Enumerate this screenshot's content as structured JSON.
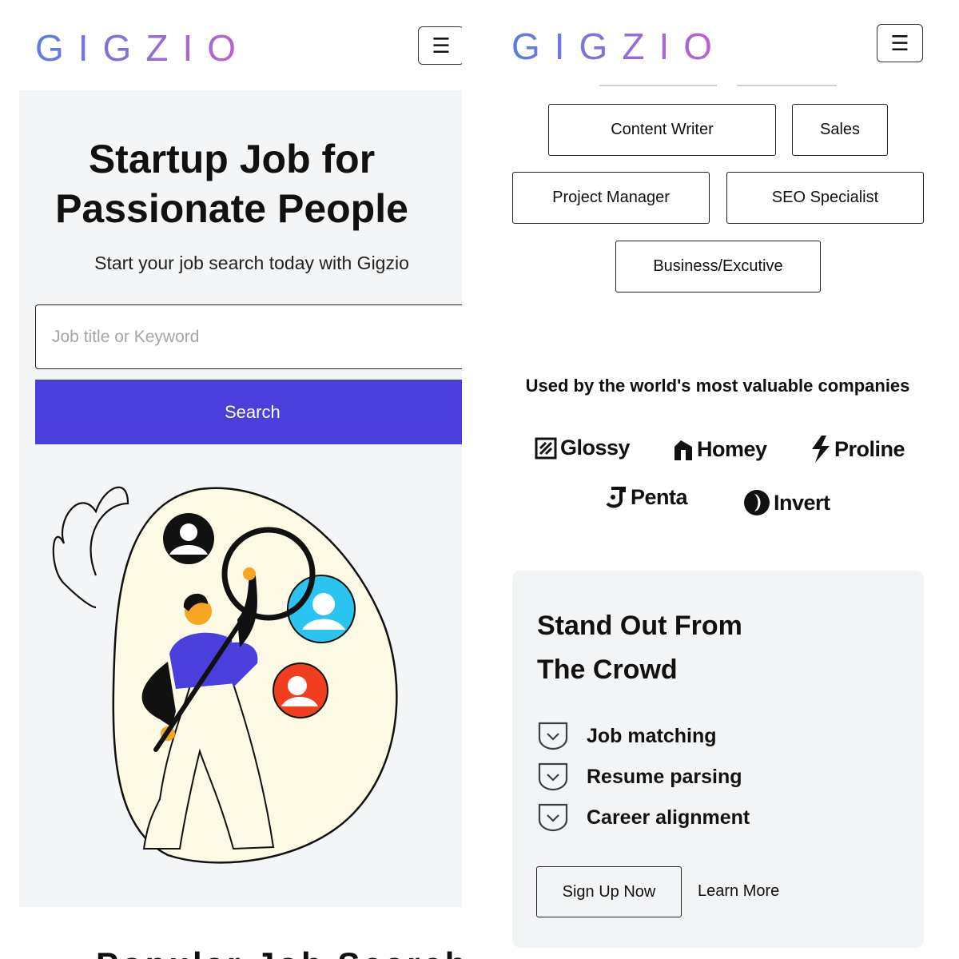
{
  "left": {
    "logo": "GIGZIO",
    "menu_icon": "hamburger-icon",
    "hero": {
      "title_line1": "Startup Job for",
      "title_line2": "Passionate People",
      "subtitle": "Start your job search today with Gigzio",
      "search_placeholder": "Job title or Keyword",
      "search_button": "Search"
    },
    "bottom_peek": "Popular Job Search"
  },
  "right": {
    "logo": "GIGZIO",
    "menu_icon": "hamburger-icon",
    "categories": [
      "Content Writer",
      "Sales",
      "Project Manager",
      "SEO Specialist",
      "Business/Excutive"
    ],
    "used_by_heading": "Used by the world's most valuable companies",
    "brands": [
      "Glossy",
      "Homey",
      "Proline",
      "Penta",
      "Invert"
    ],
    "card": {
      "title_line1": "Stand Out From",
      "title_line2": "The Crowd",
      "features": [
        "Job matching",
        "Resume parsing",
        "Career alignment"
      ],
      "feature_icon": "chevron-shield-icon",
      "signup_button": "Sign Up Now",
      "learn_more": "Learn More"
    }
  },
  "colors": {
    "primary": "#4a3fdc",
    "logo_gradient_start": "#5a7de3",
    "logo_gradient_end": "#c260c9",
    "hero_bg": "#f4f5f7",
    "card_bg": "#f3f4f6"
  }
}
